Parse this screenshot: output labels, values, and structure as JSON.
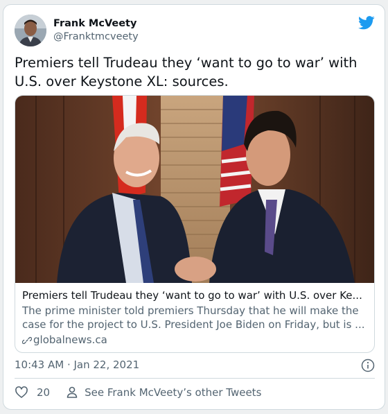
{
  "author": {
    "display_name": "Frank McVeety",
    "handle": "@Franktmcveety"
  },
  "tweet": {
    "text": "Premiers tell Trudeau they ‘want to go to war’ with U.S. over Keystone XL: sources."
  },
  "card": {
    "title": "Premiers tell Trudeau they ‘want to go to war’ with U.S. over Ke...",
    "description": "The prime minister told premiers Thursday that he will make the case for the project to U.S. President Joe Biden on Friday, but is ...",
    "domain": "globalnews.ca"
  },
  "meta": {
    "timestamp": "10:43 AM · Jan 22, 2021"
  },
  "actions": {
    "like_count": "20",
    "profile_link": "See Frank McVeety’s other Tweets"
  },
  "icons": {
    "brand": "twitter-bird-icon",
    "info": "info-icon",
    "like": "heart-icon",
    "profile": "person-icon",
    "link": "link-icon"
  },
  "colors": {
    "brand": "#1d9bf0",
    "secondary_text": "#536471",
    "border": "#cfd9de"
  }
}
